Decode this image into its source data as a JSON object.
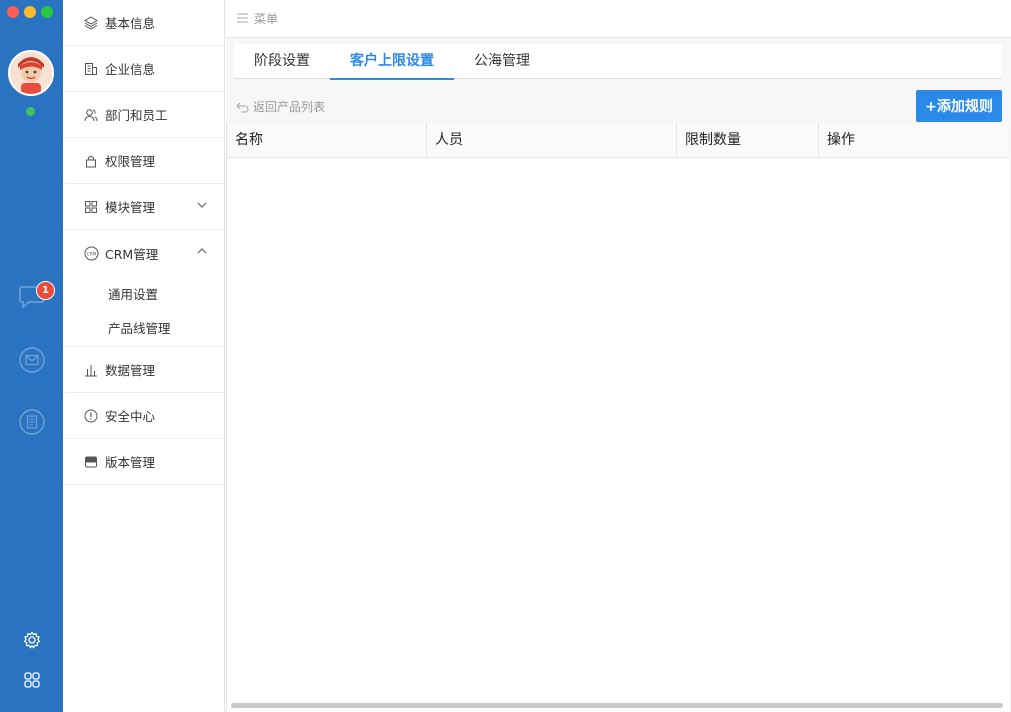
{
  "rail": {
    "badge_count": "1",
    "icons": [
      "chat-icon",
      "mail-icon",
      "document-icon",
      "settings-icon",
      "apps-icon"
    ],
    "colors": {
      "rail_bg": "#2a73c0",
      "badge": "#e84a3b",
      "online": "#3ec45a"
    }
  },
  "sidebar": {
    "items": [
      {
        "label": "基本信息",
        "icon": "layers-icon"
      },
      {
        "label": "企业信息",
        "icon": "building-icon"
      },
      {
        "label": "部门和员工",
        "icon": "users-icon"
      },
      {
        "label": "权限管理",
        "icon": "lock-icon"
      },
      {
        "label": "模块管理",
        "icon": "grid-icon",
        "expanded": false
      },
      {
        "label": "CRM管理",
        "icon": "crm-icon",
        "expanded": true
      },
      {
        "label": "数据管理",
        "icon": "bar-chart-icon"
      },
      {
        "label": "安全中心",
        "icon": "alert-circle-icon"
      },
      {
        "label": "版本管理",
        "icon": "version-icon"
      }
    ],
    "crm_subitems": [
      "通用设置",
      "产品线管理"
    ]
  },
  "topbar": {
    "menu_label": "菜单"
  },
  "tabs": [
    {
      "label": "阶段设置",
      "active": false
    },
    {
      "label": "客户上限设置",
      "active": true
    },
    {
      "label": "公海管理",
      "active": false
    }
  ],
  "toolbar": {
    "back_label": "返回产品列表",
    "add_label": "+添加规则"
  },
  "table": {
    "columns": [
      "名称",
      "人员",
      "限制数量",
      "操作"
    ],
    "rows": []
  },
  "accent": "#2e8ae6"
}
